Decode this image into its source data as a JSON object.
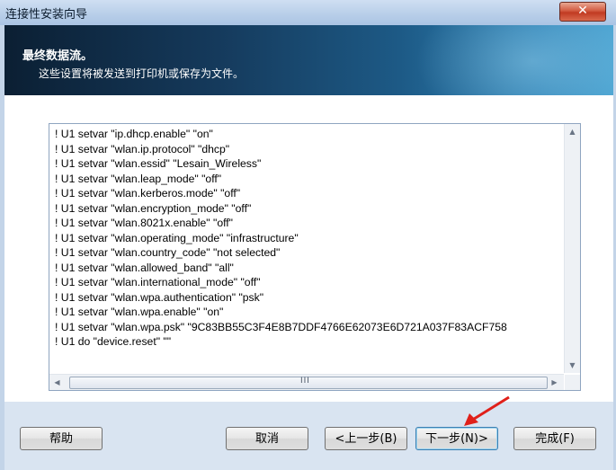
{
  "window": {
    "title": "连接性安装向导",
    "close_glyph": "✕"
  },
  "header": {
    "title": "最终数据流。",
    "subtitle": "这些设置将被发送到打印机或保存为文件。"
  },
  "code_lines": [
    "! U1 setvar \"ip.dhcp.enable\" \"on\"",
    "! U1 setvar \"wlan.ip.protocol\" \"dhcp\"",
    "! U1 setvar \"wlan.essid\" \"Lesain_Wireless\"",
    "! U1 setvar \"wlan.leap_mode\" \"off\"",
    "! U1 setvar \"wlan.kerberos.mode\" \"off\"",
    "! U1 setvar \"wlan.encryption_mode\" \"off\"",
    "! U1 setvar \"wlan.8021x.enable\" \"off\"",
    "! U1 setvar \"wlan.operating_mode\" \"infrastructure\"",
    "! U1 setvar \"wlan.country_code\" \"not selected\"",
    "! U1 setvar \"wlan.allowed_band\" \"all\"",
    "! U1 setvar \"wlan.international_mode\" \"off\"",
    "! U1 setvar \"wlan.wpa.authentication\" \"psk\"",
    "! U1 setvar \"wlan.wpa.enable\" \"on\"",
    "! U1 setvar \"wlan.wpa.psk\" \"9C83BB55C3F4E8B7DDF4766E62073E6D721A037F83ACF758",
    "! U1 do \"device.reset\" \"\""
  ],
  "scrollbar": {
    "up_glyph": "▲",
    "down_glyph": "▼",
    "left_glyph": "◀",
    "right_glyph": "▶",
    "grip_glyph": "III"
  },
  "buttons": {
    "help": "帮助",
    "cancel": "取消",
    "back": "<上一步(B)",
    "next": "下一步(N)>",
    "finish": "完成(F)"
  },
  "colors": {
    "annotation_arrow": "#e0201a"
  }
}
